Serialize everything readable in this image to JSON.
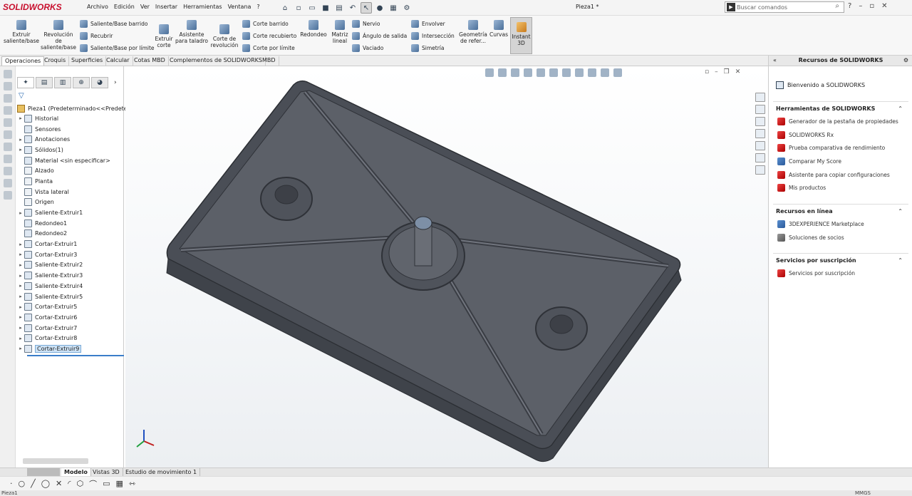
{
  "app": {
    "brand": "SOLIDWORKS",
    "doc_title": "Pieza1 *",
    "search_placeholder": "Buscar comandos"
  },
  "menu": [
    "Archivo",
    "Edición",
    "Ver",
    "Insertar",
    "Herramientas",
    "Ventana",
    "?"
  ],
  "ribbon": {
    "large": [
      {
        "label": "Extruir saliente/base",
        "icon": "extrude-boss-icon"
      },
      {
        "label": "Revolución de saliente/base",
        "icon": "revolve-boss-icon"
      },
      {
        "label": "Extruir corte",
        "icon": "extrude-cut-icon"
      },
      {
        "label": "Asistente para taladro",
        "icon": "hole-wizard-icon"
      },
      {
        "label": "Corte de revolución",
        "icon": "revolve-cut-icon"
      },
      {
        "label": "Redondeo",
        "icon": "fillet-icon"
      },
      {
        "label": "Matriz lineal",
        "icon": "linear-pattern-icon"
      },
      {
        "label": "Geometría de refer...",
        "icon": "reference-geometry-icon"
      },
      {
        "label": "Curvas",
        "icon": "curves-icon"
      },
      {
        "label": "Instant 3D",
        "icon": "instant3d-icon"
      }
    ],
    "small_a": [
      "Saliente/Base barrido",
      "Recubrir",
      "Saliente/Base por límite"
    ],
    "small_b": [
      "Corte barrido",
      "Corte recubierto",
      "Corte por límite"
    ],
    "small_c": [
      "Nervio",
      "Ángulo de salida",
      "Vaciado"
    ],
    "small_d": [
      "Envolver",
      "Intersección",
      "Simetría"
    ]
  },
  "tabs": [
    "Operaciones",
    "Croquis",
    "Superficies",
    "Calcular",
    "Cotas MBD",
    "Complementos de SOLIDWORKS",
    "MBD"
  ],
  "feature_tree": {
    "root": "Pieza1  (Predeterminado<<Predeterm",
    "nodes": [
      {
        "label": "Historial",
        "expandable": true
      },
      {
        "label": "Sensores",
        "expandable": false
      },
      {
        "label": "Anotaciones",
        "expandable": true
      },
      {
        "label": "Sólidos(1)",
        "expandable": true
      },
      {
        "label": "Material <sin especificar>",
        "expandable": false
      },
      {
        "label": "Alzado",
        "expandable": false
      },
      {
        "label": "Planta",
        "expandable": false
      },
      {
        "label": "Vista lateral",
        "expandable": false
      },
      {
        "label": "Origen",
        "expandable": false
      },
      {
        "label": "Saliente-Extruir1",
        "expandable": true
      },
      {
        "label": "Redondeo1",
        "expandable": false
      },
      {
        "label": "Redondeo2",
        "expandable": false
      },
      {
        "label": "Cortar-Extruir1",
        "expandable": true
      },
      {
        "label": "Cortar-Extruir3",
        "expandable": true
      },
      {
        "label": "Saliente-Extruir2",
        "expandable": true
      },
      {
        "label": "Saliente-Extruir3",
        "expandable": true
      },
      {
        "label": "Saliente-Extruir4",
        "expandable": true
      },
      {
        "label": "Saliente-Extruir5",
        "expandable": true
      },
      {
        "label": "Cortar-Extruir5",
        "expandable": true
      },
      {
        "label": "Cortar-Extruir6",
        "expandable": true
      },
      {
        "label": "Cortar-Extruir7",
        "expandable": true
      },
      {
        "label": "Cortar-Extruir8",
        "expandable": true
      },
      {
        "label": "Cortar-Extruir9",
        "expandable": true,
        "selected": true
      }
    ]
  },
  "task_pane": {
    "title": "Recursos de SOLIDWORKS",
    "welcome": "Bienvenido a SOLIDWORKS",
    "sections": [
      {
        "title": "Herramientas de SOLIDWORKS",
        "items": [
          "Generador de la pestaña de propiedades",
          "SOLIDWORKS Rx",
          "Prueba comparativa de rendimiento",
          "Comparar My Score",
          "Asistente para copiar configuraciones",
          "Mis productos"
        ]
      },
      {
        "title": "Recursos en línea",
        "items": [
          "3DEXPERIENCE Marketplace",
          "Soluciones de socios"
        ]
      },
      {
        "title": "Servicios por suscripción",
        "items": [
          "Servicios por suscripción"
        ]
      }
    ]
  },
  "bottom_tabs": [
    "Modelo",
    "Vistas 3D",
    "Estudio de movimiento 1"
  ],
  "status": {
    "left": "Pieza1",
    "units": "MMGS"
  },
  "colors": {
    "brand_red": "#c8102e",
    "selection_blue": "#3a7dc9",
    "part_gray": "#5c6068"
  }
}
